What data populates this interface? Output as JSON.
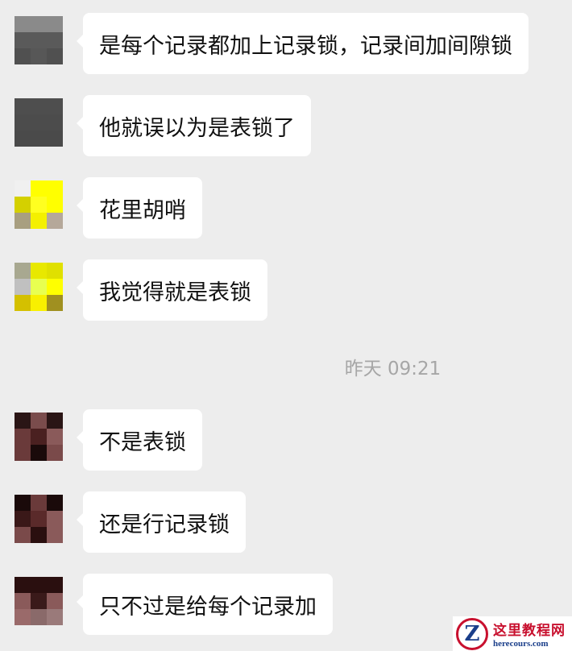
{
  "messages": [
    {
      "text": "是每个记录都加上记录锁，记录间加间隙锁",
      "avatar": [
        "#8a8a8a",
        "#8a8a8a",
        "#8a8a8a",
        "#5a5a5a",
        "#5a5a5a",
        "#5a5a5a",
        "#505050",
        "#575757",
        "#505050"
      ]
    },
    {
      "text": "他就误以为是表锁了",
      "avatar": [
        "#4e4e4e",
        "#4e4e4e",
        "#4e4e4e",
        "#4c4c4c",
        "#4c4c4c",
        "#4c4c4c",
        "#4a4a4a",
        "#4a4a4a",
        "#4a4a4a"
      ]
    },
    {
      "text": "花里胡哨",
      "avatar": [
        "#f0f0f0",
        "#ffff00",
        "#ffff00",
        "#d4d000",
        "#ffff20",
        "#ffff00",
        "#a89f80",
        "#f4f000",
        "#b5a89a"
      ]
    },
    {
      "text": "我觉得就是表锁",
      "avatar": [
        "#a8a890",
        "#e8e800",
        "#e0e000",
        "#c0c0c0",
        "#e8ff50",
        "#ffff00",
        "#d4c000",
        "#f8f000",
        "#a09020"
      ]
    },
    {
      "text": "不是表锁",
      "avatar": [
        "#2a1515",
        "#7a4c4c",
        "#2a1515",
        "#6a3a3a",
        "#4a2020",
        "#8a5a5a",
        "#6a3a3a",
        "#1a0a0a",
        "#7a4a4a"
      ]
    },
    {
      "text": "还是行记录锁",
      "avatar": [
        "#1a0a0a",
        "#6a3a3a",
        "#1a0a0a",
        "#3a1818",
        "#5a2a2a",
        "#8a5a5a",
        "#7a4a4a",
        "#2a0f0f",
        "#8a5a5a"
      ]
    },
    {
      "text": "只不过是给每个记录加",
      "avatar": [
        "#2a0f0f",
        "#2a0f0f",
        "#2a0f0f",
        "#8a5a5a",
        "#3a1a1a",
        "#8a5a5a",
        "#9a6a6a",
        "#8a6a6a",
        "#9a7a7a"
      ]
    }
  ],
  "timestamp": "昨天 09:21",
  "watermark": {
    "title": "这里教程网",
    "url": "herecours.com",
    "logo_letter": "Z"
  }
}
